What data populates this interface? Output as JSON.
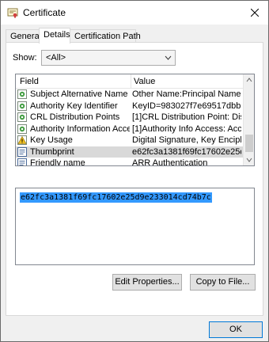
{
  "window": {
    "title": "Certificate",
    "title_icon": "certificate-icon",
    "close_icon": "close-icon"
  },
  "tabs": [
    {
      "label": "General",
      "active": false
    },
    {
      "label": "Details",
      "active": true
    },
    {
      "label": "Certification Path",
      "active": false
    }
  ],
  "details": {
    "show_label": "Show:",
    "show_value": "<All>",
    "columns": {
      "field": "Field",
      "value": "Value"
    },
    "rows": [
      {
        "field": "Subject Alternative Name",
        "value": "Other Name:Principal Name=Vi...",
        "icon": "cert-field-green-icon",
        "selected": false
      },
      {
        "field": "Authority Key Identifier",
        "value": "KeyID=983027f7e69517dbb5...",
        "icon": "cert-field-green-icon",
        "selected": false
      },
      {
        "field": "CRL Distribution Points",
        "value": "[1]CRL Distribution Point: Distr...",
        "icon": "cert-field-green-icon",
        "selected": false
      },
      {
        "field": "Authority Information Access",
        "value": "[1]Authority Info Access: Acc...",
        "icon": "cert-field-green-icon",
        "selected": false
      },
      {
        "field": "Key Usage",
        "value": "Digital Signature, Key Encipher...",
        "icon": "key-warning-icon",
        "selected": false
      },
      {
        "field": "Thumbprint",
        "value": "e62fc3a1381f69fc17602e25d...",
        "icon": "property-page-icon",
        "selected": true
      },
      {
        "field": "Friendly name",
        "value": "ARR Authentication",
        "icon": "property-page-icon",
        "selected": false
      }
    ],
    "detail_value": "e62fc3a1381f69fc17602e25d9e233014cd74b7c",
    "edit_properties_label": "Edit Properties...",
    "copy_to_file_label": "Copy to File..."
  },
  "footer": {
    "ok_label": "OK"
  },
  "colors": {
    "selection": "#3399ff",
    "row_selected": "#d9d9d9",
    "ok_border": "#0078d7"
  }
}
